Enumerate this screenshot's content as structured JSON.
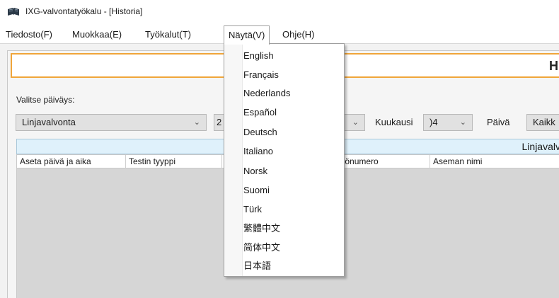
{
  "window": {
    "title": "IXG-valvontatyökalu - [Historia]",
    "icon": "app-book-icon"
  },
  "menubar": {
    "items": [
      {
        "label": "Tiedosto(F)"
      },
      {
        "label": "Muokkaa(E)"
      },
      {
        "label": "Työkalut(T)"
      },
      {
        "label": "Näytä(V)",
        "open": true
      },
      {
        "label": "Ohje(H)"
      }
    ]
  },
  "language_menu": {
    "items": [
      {
        "label": "English"
      },
      {
        "label": "Français"
      },
      {
        "label": "Nederlands"
      },
      {
        "label": "Español"
      },
      {
        "label": "Deutsch"
      },
      {
        "label": "Italiano"
      },
      {
        "label": "Norsk"
      },
      {
        "label": "Suomi"
      },
      {
        "label": "Türk"
      },
      {
        "label": "繁體中文"
      },
      {
        "label": "简体中文"
      },
      {
        "label": "日本語"
      }
    ]
  },
  "header": {
    "title": "Hi"
  },
  "filters": {
    "date_label": "Valitse päiväys:",
    "category_value": "Linjavalvonta",
    "hidden_value": "2",
    "month_label": "Kuukausi",
    "month_value": ")4",
    "day_label": "Päivä",
    "day_value": "Kaikk"
  },
  "table": {
    "group_title": "Linjavalv",
    "columns": [
      {
        "label": "Aseta päivä ja aika"
      },
      {
        "label": "Testin tyyppi"
      },
      {
        "label": ""
      },
      {
        "label": "aikkönumero"
      },
      {
        "label": "Aseman nimi"
      }
    ]
  },
  "colors": {
    "accent_border": "#f0a53a",
    "table_header_bg": "#dff1fb",
    "combo_bg": "#e1e1e1",
    "table_body_bg": "#d6d6d6"
  }
}
